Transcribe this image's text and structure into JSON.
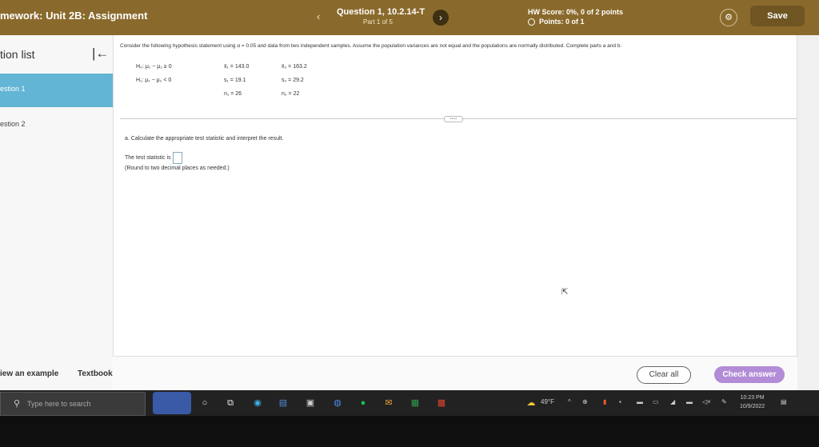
{
  "header": {
    "title": "mework: Unit 2B: Assignment",
    "prev_icon": "chevron-left-icon",
    "prev_glyph": "‹",
    "question": "Question 1, 10.2.14-T",
    "part": "Part 1 of 5",
    "next_icon": "chevron-right-icon",
    "next_glyph": "›",
    "hw_score": "HW Score: 0%, 0 of 2 points",
    "points": "Points: 0 of 1",
    "settings_icon": "gear-icon",
    "settings_glyph": "⚙",
    "save_label": "Save",
    "bar_color": "#8a6a2c"
  },
  "sidebar": {
    "heading": "tion list",
    "collapse_icon": "collapse-left-icon",
    "collapse_glyph": "|←",
    "items": [
      {
        "label": "estion 1",
        "active": true
      },
      {
        "label": "estion 2",
        "active": false
      }
    ],
    "example_label": "iew an example",
    "textbook_label": "Textbook",
    "active_color": "#62b5d4"
  },
  "question": {
    "intro": "Consider the following hypothesis statement using α = 0.05 and data from two independent samples. Assume the population variances are not equal and the populations are normally distributed. Complete parts a and b.",
    "h0": "H₀: μ₁ − μ₂ ≥ 0",
    "h1": "H₁: μ₁ − μ₂ < 0",
    "x1": "x̄₁ = 143.0",
    "s1": "s₁ = 19.1",
    "n1": "n₁ = 26",
    "x2": "x̄₂ = 163.2",
    "s2": "s₂ = 29.2",
    "n2": "n₂ = 22",
    "part_a": "a. Calculate the appropriate test statistic and interpret the result.",
    "ts_label": "The test statistic is",
    "ts_value": "",
    "round_note": "(Round to two decimal places as needed.)",
    "divider_handle": "•••••"
  },
  "footer": {
    "clear_label": "Clear all",
    "check_label": "Check answer",
    "check_color": "#b28cd6"
  },
  "taskbar": {
    "search_icon": "search-icon",
    "search_placeholder": "Type here to search",
    "weather": "49°F",
    "time": "10:23 PM",
    "date": "10/9/2022"
  }
}
